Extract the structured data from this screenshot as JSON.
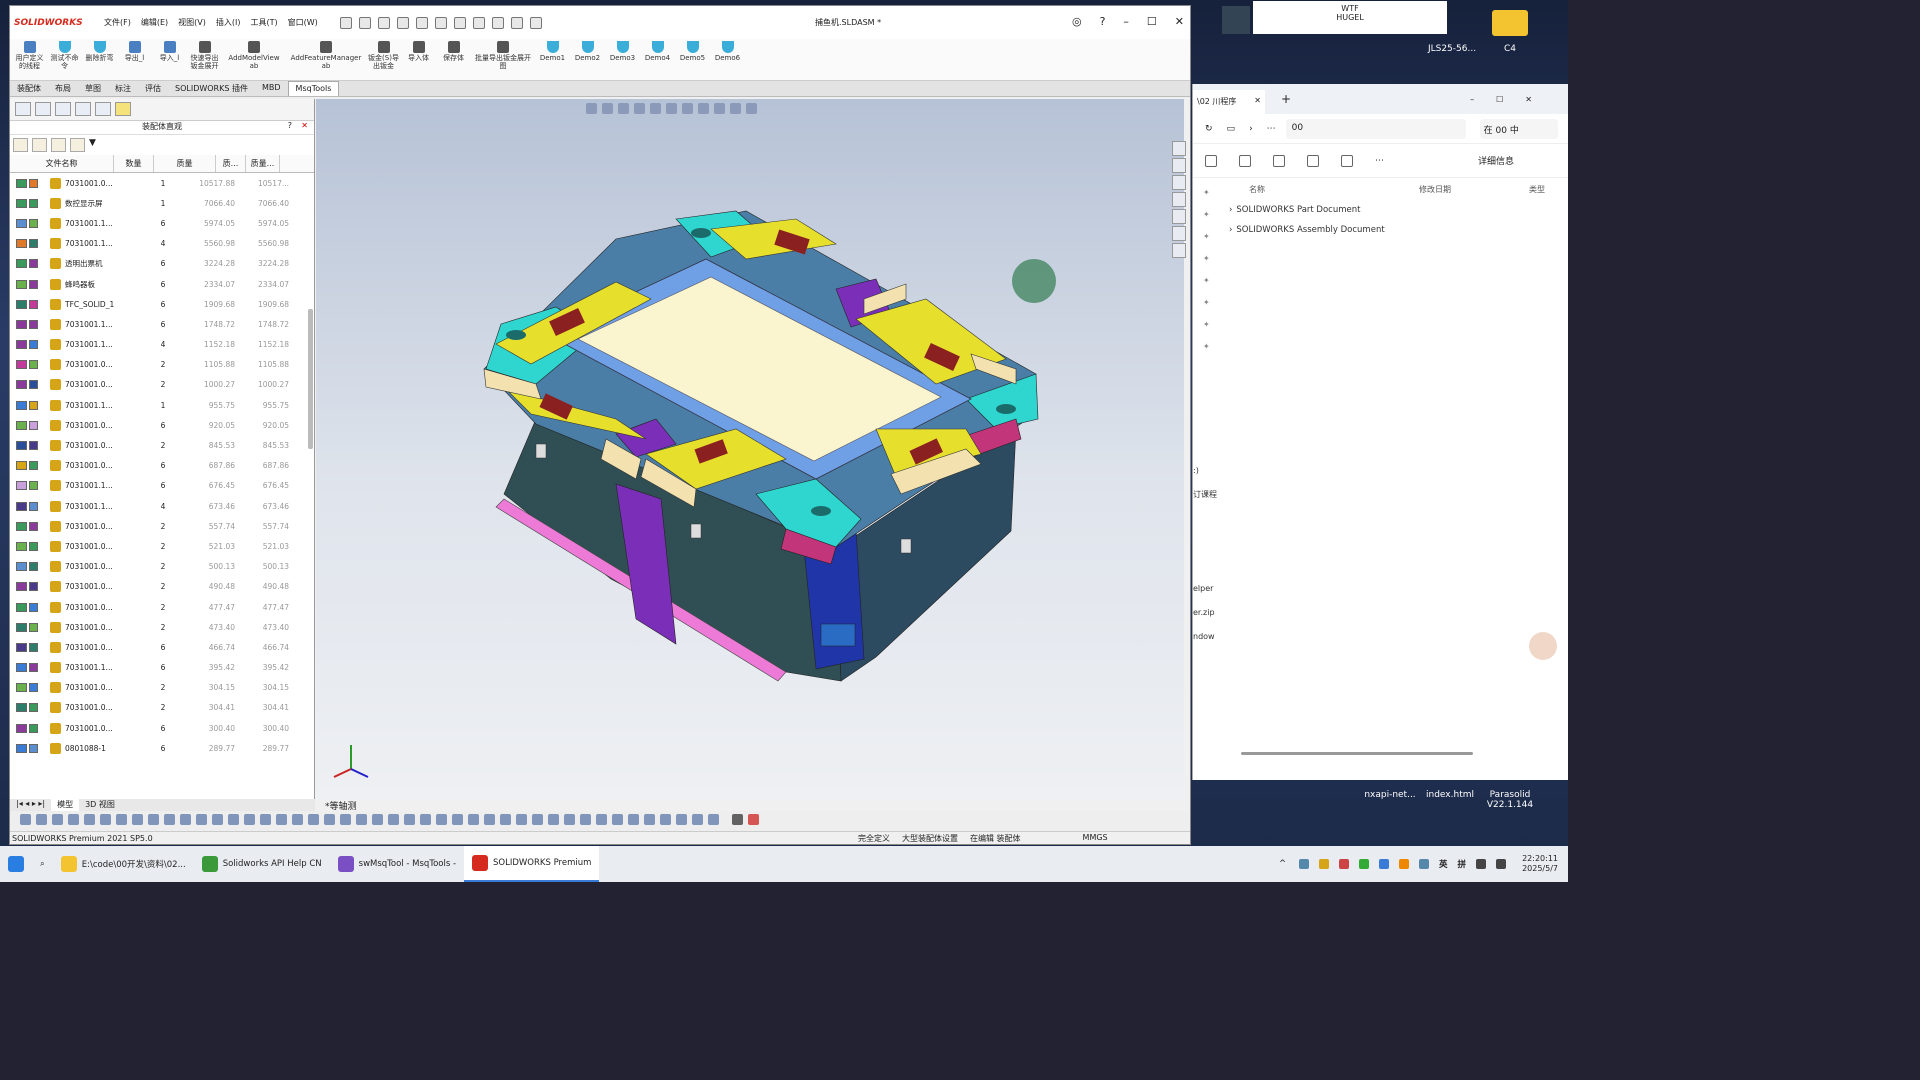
{
  "sw": {
    "logo": "SOLIDWORKS",
    "menus": [
      "文件(F)",
      "编辑(E)",
      "视图(V)",
      "插入(I)",
      "工具(T)",
      "窗口(W)"
    ],
    "doc_title": "捕鱼机.SLDASM *",
    "ribbon": [
      "用户定义的线程",
      "测试不命令",
      "删除折弯",
      "导出_l",
      "导入_l",
      "快速导出钣金展开",
      "AddModelView ab",
      "AddFeatureManager ab",
      "钣金(S)导出钣金",
      "导入体",
      "保存体",
      "批量导出钣金展开图",
      "Demo1",
      "Demo2",
      "Demo3",
      "Demo4",
      "Demo5",
      "Demo6"
    ],
    "tabs": [
      "装配体",
      "布局",
      "草图",
      "标注",
      "评估",
      "SOLIDWORKS 插件",
      "MBD",
      "MsqTools"
    ],
    "bom": {
      "title": "装配体直观",
      "headers": [
        "文件名称",
        "数量",
        "质量",
        "质...",
        "质量..."
      ],
      "rows": [
        {
          "name": "7031001.0...",
          "qty": "1",
          "m1": "10517.88",
          "m2": "10517..."
        },
        {
          "name": "数控显示屏",
          "qty": "1",
          "m1": "7066.40",
          "m2": "7066.40"
        },
        {
          "name": "7031001.1...",
          "qty": "6",
          "m1": "5974.05",
          "m2": "5974.05"
        },
        {
          "name": "7031001.1...",
          "qty": "4",
          "m1": "5560.98",
          "m2": "5560.98"
        },
        {
          "name": "透明出票机",
          "qty": "6",
          "m1": "3224.28",
          "m2": "3224.28"
        },
        {
          "name": "蜂鸣器板",
          "qty": "6",
          "m1": "2334.07",
          "m2": "2334.07"
        },
        {
          "name": "TFC_SOLID_1",
          "qty": "6",
          "m1": "1909.68",
          "m2": "1909.68"
        },
        {
          "name": "7031001.1...",
          "qty": "6",
          "m1": "1748.72",
          "m2": "1748.72"
        },
        {
          "name": "7031001.1...",
          "qty": "4",
          "m1": "1152.18",
          "m2": "1152.18"
        },
        {
          "name": "7031001.0...",
          "qty": "2",
          "m1": "1105.88",
          "m2": "1105.88"
        },
        {
          "name": "7031001.0...",
          "qty": "2",
          "m1": "1000.27",
          "m2": "1000.27"
        },
        {
          "name": "7031001.1...",
          "qty": "1",
          "m1": "955.75",
          "m2": "955.75"
        },
        {
          "name": "7031001.0...",
          "qty": "6",
          "m1": "920.05",
          "m2": "920.05"
        },
        {
          "name": "7031001.0...",
          "qty": "2",
          "m1": "845.53",
          "m2": "845.53"
        },
        {
          "name": "7031001.0...",
          "qty": "6",
          "m1": "687.86",
          "m2": "687.86"
        },
        {
          "name": "7031001.1...",
          "qty": "6",
          "m1": "676.45",
          "m2": "676.45"
        },
        {
          "name": "7031001.1...",
          "qty": "4",
          "m1": "673.46",
          "m2": "673.46"
        },
        {
          "name": "7031001.0...",
          "qty": "2",
          "m1": "557.74",
          "m2": "557.74"
        },
        {
          "name": "7031001.0...",
          "qty": "2",
          "m1": "521.03",
          "m2": "521.03"
        },
        {
          "name": "7031001.0...",
          "qty": "2",
          "m1": "500.13",
          "m2": "500.13"
        },
        {
          "name": "7031001.0...",
          "qty": "2",
          "m1": "490.48",
          "m2": "490.48"
        },
        {
          "name": "7031001.0...",
          "qty": "2",
          "m1": "477.47",
          "m2": "477.47"
        },
        {
          "name": "7031001.0...",
          "qty": "2",
          "m1": "473.40",
          "m2": "473.40"
        },
        {
          "name": "7031001.0...",
          "qty": "6",
          "m1": "466.74",
          "m2": "466.74"
        },
        {
          "name": "7031001.1...",
          "qty": "6",
          "m1": "395.42",
          "m2": "395.42"
        },
        {
          "name": "7031001.0...",
          "qty": "2",
          "m1": "304.15",
          "m2": "304.15"
        },
        {
          "name": "7031001.0...",
          "qty": "2",
          "m1": "304.41",
          "m2": "304.41"
        },
        {
          "name": "7031001.0...",
          "qty": "6",
          "m1": "300.40",
          "m2": "300.40"
        },
        {
          "name": "0801088-1",
          "qty": "6",
          "m1": "289.77",
          "m2": "289.77"
        }
      ]
    },
    "bottom_tabs": [
      "模型",
      "3D 视图"
    ],
    "view_label": "*等轴测",
    "status_left": "SOLIDWORKS Premium 2021 SP5.0",
    "status_right": [
      "完全定义",
      "大型装配体设置",
      "在编辑 装配体",
      "MMGS"
    ]
  },
  "explorer": {
    "tab": "\\02 川程序",
    "address": "00",
    "search": "在 00 中",
    "details_btn": "详细信息",
    "cols": [
      "名称",
      "修改日期",
      "类型"
    ],
    "items": [
      "SOLIDWORKS Part Document",
      "SOLIDWORKS Assembly Document"
    ],
    "side": [
      ":)",
      "订课程",
      "elper",
      "er.zip",
      "ndow"
    ]
  },
  "desktop": {
    "notify_title": "WTF",
    "notify_sub": "HUGEL",
    "icons": [
      "JLS25-56...",
      "C4",
      "nxapi-net...",
      "index.html",
      "Parasolid V22.1.144"
    ]
  },
  "taskbar": {
    "items": [
      "E:\\code\\00开发\\资料\\02...",
      "Solidworks API Help CN",
      "swMsqTool - MsqTools -",
      "SOLIDWORKS Premium"
    ],
    "tray_lang": "英",
    "tray_ime": "拼",
    "time": "22:20:11",
    "date": "2025/5/7"
  }
}
